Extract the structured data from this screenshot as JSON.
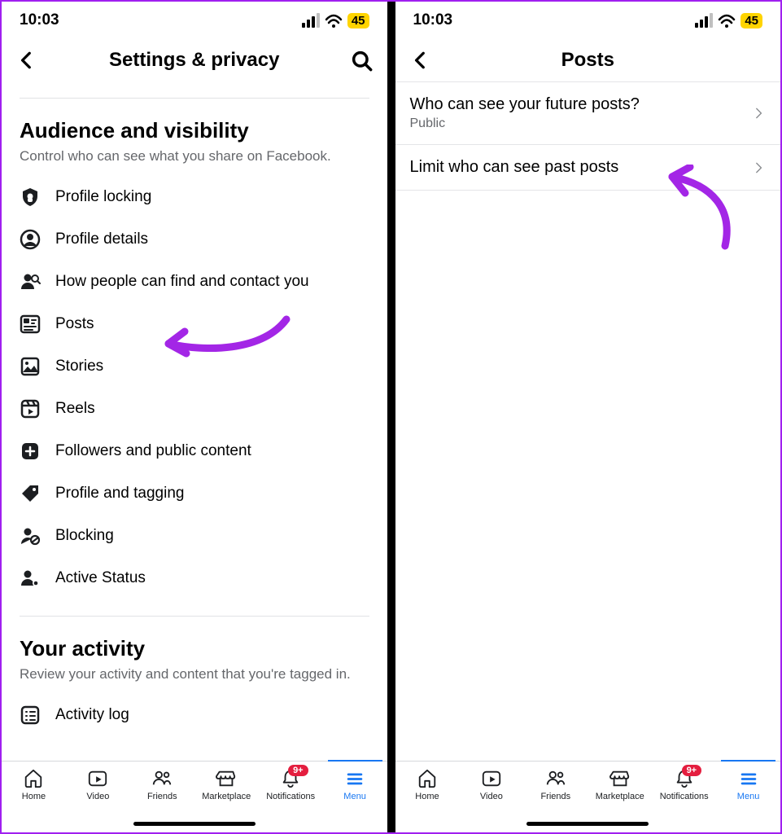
{
  "status": {
    "time": "10:03",
    "battery": "45"
  },
  "left": {
    "header": {
      "title": "Settings & privacy"
    },
    "section1": {
      "title": "Audience and visibility",
      "subtitle": "Control who can see what you share on Facebook.",
      "items": [
        {
          "label": "Profile locking"
        },
        {
          "label": "Profile details"
        },
        {
          "label": "How people can find and contact you"
        },
        {
          "label": "Posts"
        },
        {
          "label": "Stories"
        },
        {
          "label": "Reels"
        },
        {
          "label": "Followers and public content"
        },
        {
          "label": "Profile and tagging"
        },
        {
          "label": "Blocking"
        },
        {
          "label": "Active Status"
        }
      ]
    },
    "section2": {
      "title": "Your activity",
      "subtitle": "Review your activity and content that you're tagged in.",
      "items": [
        {
          "label": "Activity log"
        }
      ]
    }
  },
  "right": {
    "header": {
      "title": "Posts"
    },
    "rows": [
      {
        "title": "Who can see your future posts?",
        "subtitle": "Public"
      },
      {
        "title": "Limit who can see past posts",
        "subtitle": ""
      }
    ]
  },
  "nav": {
    "items": [
      {
        "label": "Home"
      },
      {
        "label": "Video"
      },
      {
        "label": "Friends"
      },
      {
        "label": "Marketplace"
      },
      {
        "label": "Notifications",
        "badge": "9+"
      },
      {
        "label": "Menu",
        "active": true
      }
    ]
  }
}
